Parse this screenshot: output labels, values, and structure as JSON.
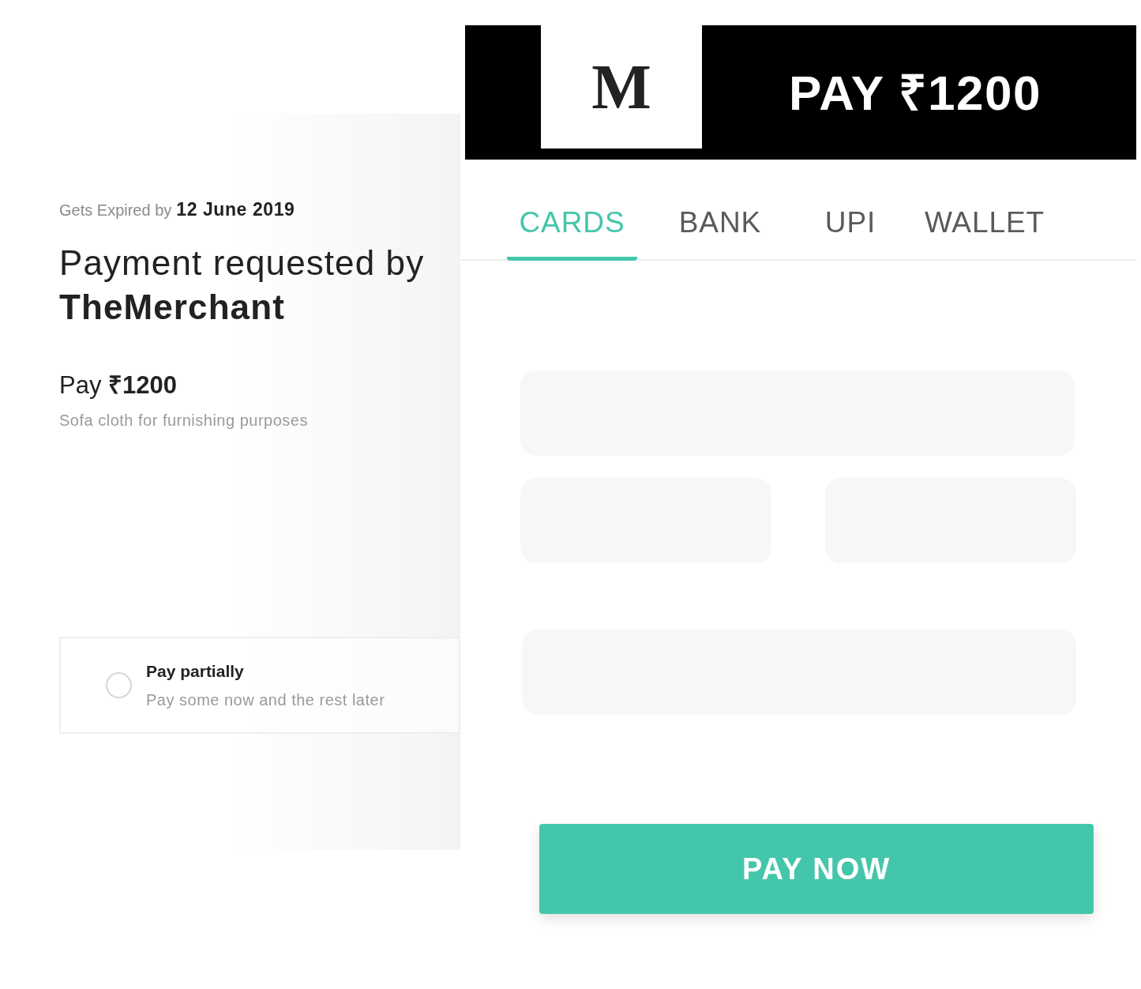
{
  "header": {
    "logo": "M",
    "amount_title": "PAY ₹1200"
  },
  "expiry": {
    "label": "Gets Expired by",
    "date": "12 June 2019"
  },
  "request": {
    "label": "Payment requested by",
    "merchant": "TheMerchant"
  },
  "payment": {
    "amount": "Pay **₹1200**",
    "description": "Sofa cloth for furnishing purposes"
  },
  "partial_option": {
    "title": "Pay partially",
    "subtitle": "Pay some now and the rest later",
    "selected": false
  },
  "tabs": [
    {
      "label": "CARDS",
      "selected": true
    },
    {
      "label": "BANK",
      "selected": false
    },
    {
      "label": "UPI",
      "selected": false
    },
    {
      "label": "WALLET",
      "selected": false
    }
  ],
  "submit": {
    "label": "PAY NOW"
  }
}
